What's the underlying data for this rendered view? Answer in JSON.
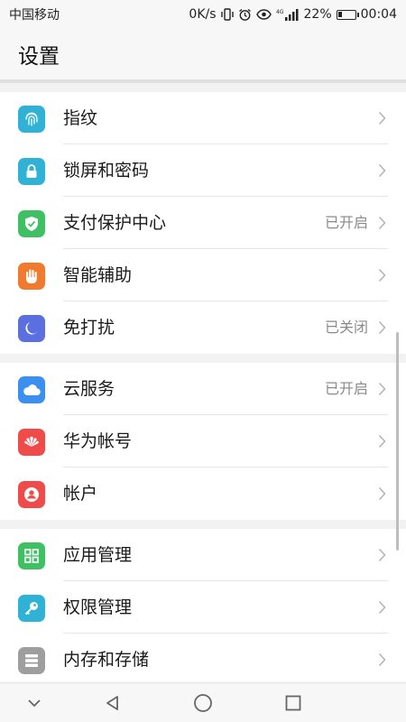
{
  "status_bar": {
    "carrier": "中国移动",
    "net_speed": "0K/s",
    "network_label": "4G",
    "battery_percent": "22%",
    "battery_level": 0.22,
    "time": "00:04"
  },
  "header": {
    "title": "设置"
  },
  "groups": [
    {
      "items": [
        {
          "label": "指纹",
          "value": "",
          "icon": "fingerprint-icon",
          "color": "#2fb2d6"
        },
        {
          "label": "锁屏和密码",
          "value": "",
          "icon": "lock-icon",
          "color": "#2fb2d6"
        },
        {
          "label": "支付保护中心",
          "value": "已开启",
          "icon": "shield-icon",
          "color": "#3ec063"
        },
        {
          "label": "智能辅助",
          "value": "",
          "icon": "hand-icon",
          "color": "#f07a2e"
        },
        {
          "label": "免打扰",
          "value": "已关闭",
          "icon": "moon-icon",
          "color": "#5b6fe0"
        }
      ]
    },
    {
      "items": [
        {
          "label": "云服务",
          "value": "已开启",
          "icon": "cloud-icon",
          "color": "#3b8ff0"
        },
        {
          "label": "华为帐号",
          "value": "",
          "icon": "huawei-icon",
          "color": "#ef4b4b"
        },
        {
          "label": "帐户",
          "value": "",
          "icon": "account-icon",
          "color": "#ef4b4b"
        }
      ]
    },
    {
      "items": [
        {
          "label": "应用管理",
          "value": "",
          "icon": "apps-icon",
          "color": "#3ec063"
        },
        {
          "label": "权限管理",
          "value": "",
          "icon": "key-icon",
          "color": "#2fb2d6"
        },
        {
          "label": "内存和存储",
          "value": "",
          "icon": "storage-icon",
          "color": "#9e9e9e"
        }
      ]
    }
  ],
  "nav_bar": {
    "icons": [
      "chevron-down-icon",
      "back-icon",
      "home-icon",
      "recents-icon"
    ]
  }
}
